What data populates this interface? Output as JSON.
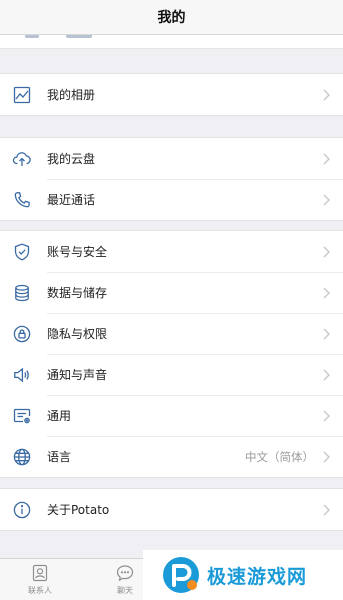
{
  "header": {
    "title": "我的"
  },
  "menu": {
    "album": {
      "label": "我的相册",
      "icon": "photo-album-icon"
    },
    "cloud": {
      "label": "我的云盘",
      "icon": "cloud-upload-icon"
    },
    "recent_calls": {
      "label": "最近通话",
      "icon": "phone-icon"
    },
    "account_security": {
      "label": "账号与安全",
      "icon": "shield-icon"
    },
    "data_storage": {
      "label": "数据与储存",
      "icon": "database-icon"
    },
    "privacy": {
      "label": "隐私与权限",
      "icon": "lock-icon"
    },
    "notifications": {
      "label": "通知与声音",
      "icon": "speaker-icon"
    },
    "general": {
      "label": "通用",
      "icon": "general-settings-icon"
    },
    "language": {
      "label": "语言",
      "value": "中文（简体）",
      "icon": "globe-icon"
    },
    "about": {
      "label": "关于Potato",
      "icon": "info-icon"
    }
  },
  "tabbar": {
    "contacts": {
      "label": "联系人",
      "icon": "contacts-icon"
    },
    "chats": {
      "label": "聊天",
      "icon": "chat-bubble-icon"
    }
  },
  "watermark": {
    "text": "极速游戏网"
  },
  "colors": {
    "icon": "#3a6aa3",
    "chevron": "#c7c7cc",
    "watermark": "#1a9bd8"
  }
}
